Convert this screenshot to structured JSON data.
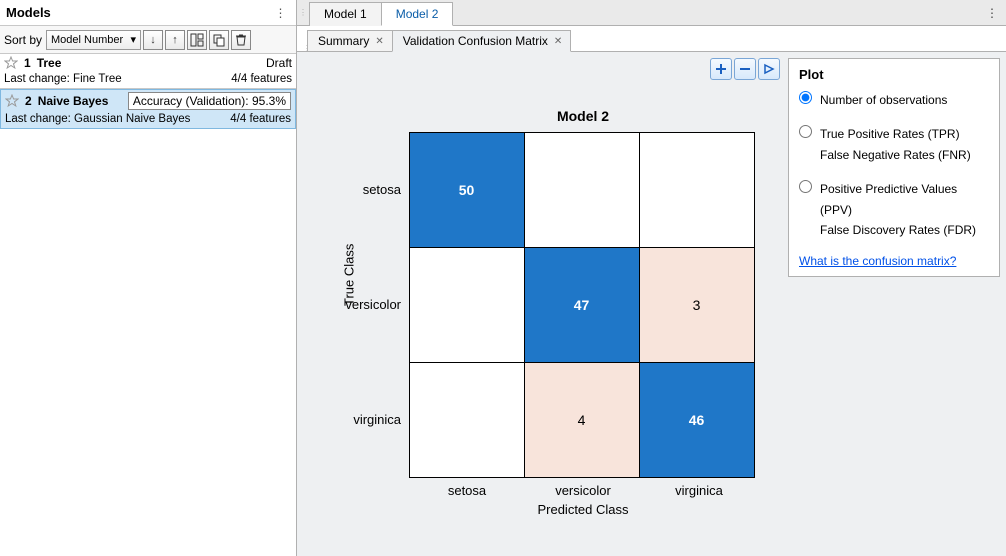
{
  "left": {
    "title": "Models",
    "sort_label": "Sort by",
    "sort_value": "Model Number",
    "items": [
      {
        "num": "1",
        "name": "Tree",
        "badge": "Draft",
        "framed": false,
        "last_change_label": "Last change: Fine Tree",
        "features": "4/4 features",
        "selected": false
      },
      {
        "num": "2",
        "name": "Naive Bayes",
        "badge": "Accuracy (Validation): 95.3%",
        "framed": true,
        "last_change_label": "Last change: Gaussian Naive Bayes",
        "features": "4/4 features",
        "selected": true
      }
    ]
  },
  "tabs_outer": [
    {
      "label": "Model 1",
      "active": false
    },
    {
      "label": "Model 2",
      "active": true
    }
  ],
  "tabs_inner": [
    {
      "label": "Summary",
      "active": false
    },
    {
      "label": "Validation Confusion Matrix",
      "active": true
    }
  ],
  "chart_data": {
    "type": "heatmap",
    "title": "Model 2",
    "xlabel": "Predicted Class",
    "ylabel": "True Class",
    "categories": [
      "setosa",
      "versicolor",
      "virginica"
    ],
    "matrix": [
      [
        50,
        0,
        0
      ],
      [
        0,
        47,
        3
      ],
      [
        0,
        4,
        46
      ]
    ]
  },
  "plot_panel": {
    "title": "Plot",
    "options": [
      {
        "label": "Number of observations",
        "checked": true
      },
      {
        "line1": "True Positive Rates (TPR)",
        "line2": "False Negative Rates (FNR)",
        "checked": false
      },
      {
        "line1": "Positive Predictive Values (PPV)",
        "line2": "False Discovery Rates (FDR)",
        "checked": false
      }
    ],
    "help": "What is the confusion matrix?"
  }
}
